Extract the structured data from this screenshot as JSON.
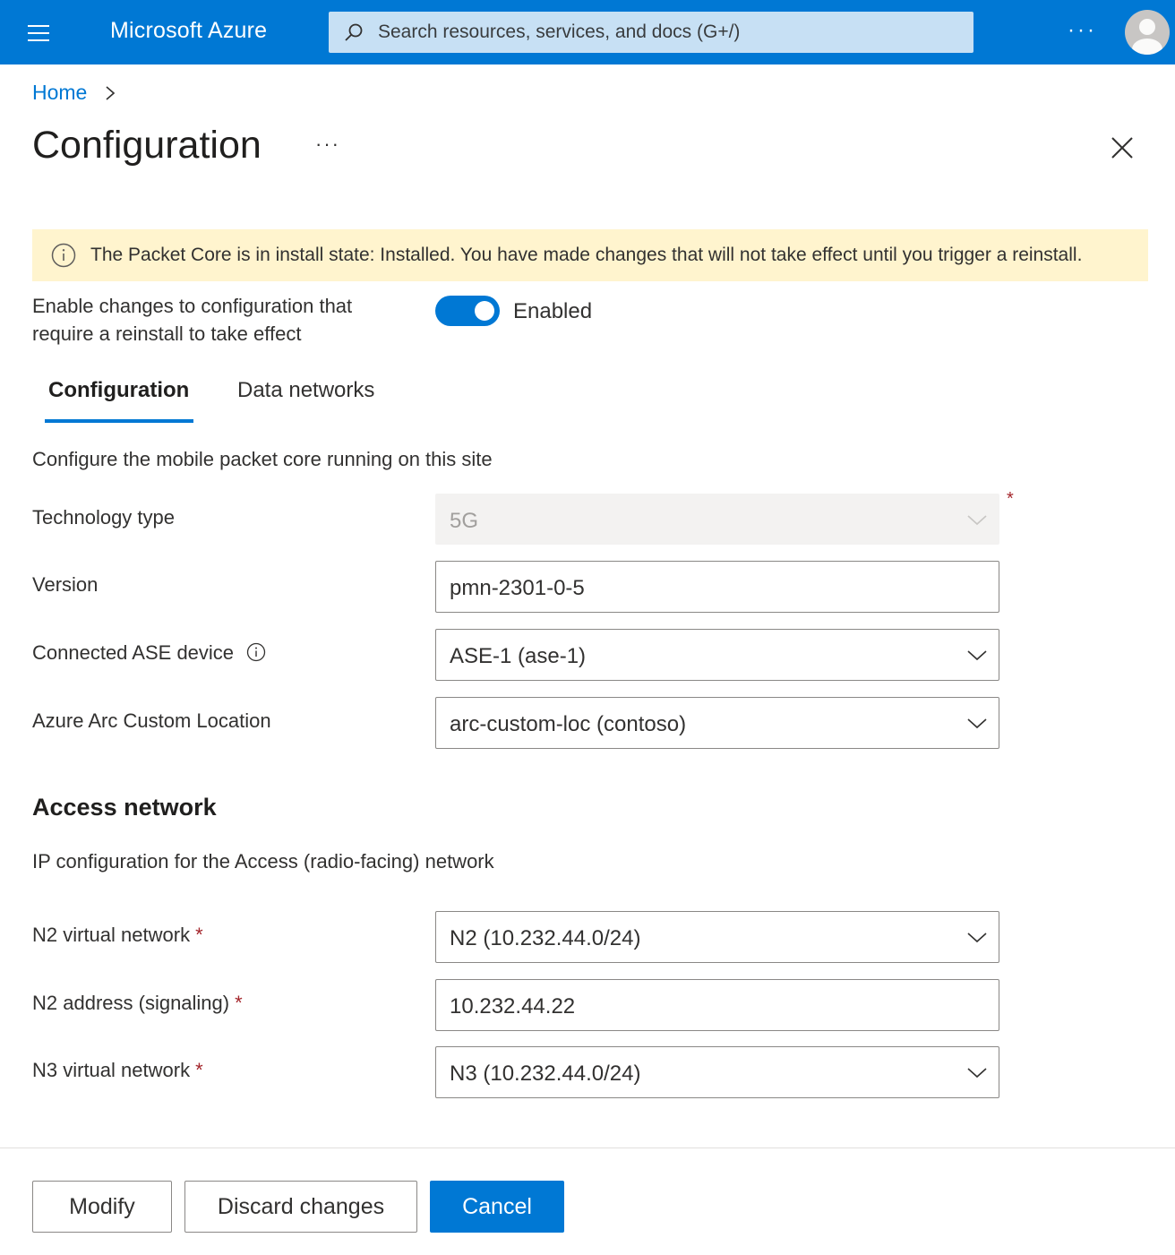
{
  "topbar": {
    "brand": "Microsoft Azure",
    "search_placeholder": "Search resources, services, and docs (G+/)",
    "more_label": "···",
    "icons": [
      "hamburger-icon",
      "search-icon",
      "more-icon",
      "avatar-icon"
    ]
  },
  "breadcrumb": {
    "home": "Home"
  },
  "page": {
    "title": "Configuration",
    "more_label": "···"
  },
  "banner": {
    "text": "The Packet Core is in install state: Installed. You have made changes that will not take effect until you trigger a reinstall."
  },
  "toggle": {
    "label_line1": "Enable changes to configuration that",
    "label_line2": "require a reinstall to take effect",
    "state": "Enabled",
    "on": true
  },
  "tabs": [
    {
      "label": "Configuration",
      "selected": true
    },
    {
      "label": "Data networks",
      "selected": false
    }
  ],
  "config": {
    "description": "Configure the mobile packet core running on this site",
    "technology_type": {
      "label": "Technology type",
      "value": "5G",
      "required": true,
      "disabled": true
    },
    "version": {
      "label": "Version",
      "value": "pmn-2301-0-5"
    },
    "ase_device": {
      "label": "Connected ASE device",
      "value": "ASE-1 (ase-1)"
    },
    "custom_location": {
      "label": "Azure Arc Custom Location",
      "value": "arc-custom-loc (contoso)"
    }
  },
  "access_network": {
    "title": "Access network",
    "description": "IP configuration for the Access (radio-facing) network",
    "n2_vnet": {
      "label": "N2 virtual network",
      "value": "N2 (10.232.44.0/24)",
      "required": true
    },
    "n2_address": {
      "label": "N2 address (signaling)",
      "value": "10.232.44.22",
      "required": true
    },
    "n3_vnet": {
      "label": "N3 virtual network",
      "value": "N3 (10.232.44.0/24)",
      "required": true
    }
  },
  "required_mark": "*",
  "buttons": {
    "modify": "Modify",
    "discard": "Discard changes",
    "cancel": "Cancel"
  },
  "colors": {
    "accent": "#0078d4",
    "banner_bg": "#fff4ce",
    "required": "#a4262c"
  }
}
